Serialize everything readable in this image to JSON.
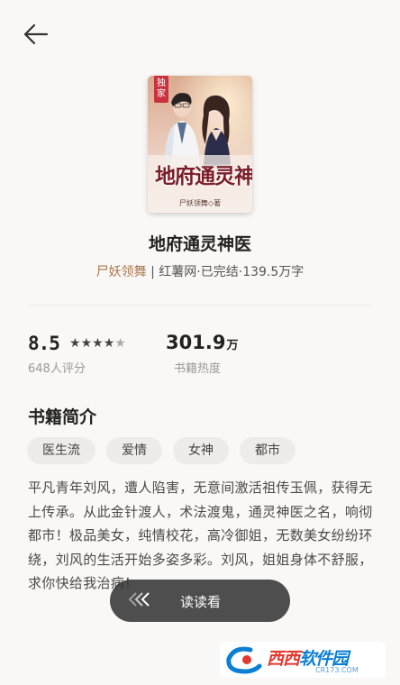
{
  "book": {
    "badge": "独家",
    "cover_title": "地府通灵神医",
    "cover_author": "尸妖领舞◇著",
    "title": "地府通灵神医",
    "author": "尸妖领舞",
    "meta_rest": " | 红薯网·已完结·139.5万字"
  },
  "stats": {
    "rating_value": "8.5",
    "rating_stars": 4.5,
    "rating_label": "648人评分",
    "heat_value": "301.9",
    "heat_unit": "万",
    "heat_label": "书籍热度"
  },
  "intro": {
    "title": "书籍简介",
    "tags": [
      "医生流",
      "爱情",
      "女神",
      "都市"
    ],
    "text": "平凡青年刘风，遭人陷害，无意间激活祖传玉佩，获得无上传承。从此金针渡人，术法渡鬼，通灵神医之名，响彻都市！极品美女，纯情校花，高冷御姐，无数美女纷纷环绕，刘风的生活开始多姿多彩。刘风，姐姐身体不舒服，求你快给我治病！"
  },
  "actions": {
    "read_label": "读读看"
  },
  "watermark": {
    "text_a": "西西",
    "text_b": "软件园",
    "url": "CR173.COM"
  },
  "colors": {
    "accent": "#a87649",
    "background": "#faf8f6",
    "button": "#323232"
  },
  "icons": {
    "back": "arrow-left-icon",
    "read": "chevrons-left-icon"
  }
}
